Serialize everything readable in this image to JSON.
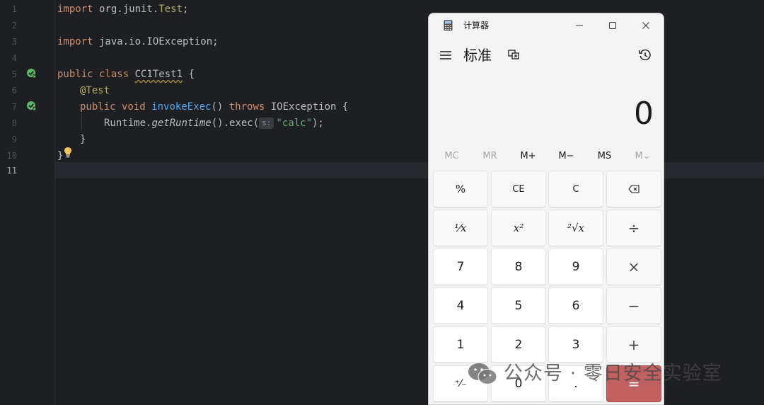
{
  "editor": {
    "line_numbers": [
      "1",
      "2",
      "3",
      "4",
      "5",
      "6",
      "7",
      "8",
      "9",
      "10",
      "11"
    ],
    "lines": {
      "l1": {
        "kw": "import",
        "pkg": " org.junit.",
        "cls": "Test",
        "end": ";"
      },
      "l3": {
        "kw": "import",
        "pkg": " java.io.IOException;"
      },
      "l5": {
        "kw": "public class ",
        "cls": "CC1Test1",
        "end": " {"
      },
      "l6": {
        "ann": "@Test"
      },
      "l7": {
        "kw1": "public void ",
        "fn": "invokeExec",
        "mid": "() ",
        "kw2": "throws",
        "end": " IOException {"
      },
      "l8": {
        "pre": "Runtime.",
        "call": "getRuntime",
        "mid": "().exec(",
        "hint": "s:",
        "str": "\"calc\"",
        "end": ");"
      },
      "l9": {
        "text": "}"
      },
      "l10": {
        "text": "}"
      }
    }
  },
  "calculator": {
    "window_title": "计算器",
    "mode_title": "标准",
    "display_value": "0",
    "memory": [
      "MC",
      "MR",
      "M+",
      "M−",
      "MS",
      "M⌄"
    ],
    "keys": [
      [
        "%",
        "CE",
        "C",
        "⌫"
      ],
      [
        "¹⁄x",
        "x²",
        "²√x",
        "÷"
      ],
      [
        "7",
        "8",
        "9",
        "×"
      ],
      [
        "4",
        "5",
        "6",
        "−"
      ],
      [
        "1",
        "2",
        "3",
        "+"
      ],
      [
        "⁺⁄₋",
        "0",
        ".",
        "="
      ]
    ],
    "colors": {
      "accent": "#c06060",
      "background": "#f3f3f3"
    }
  },
  "watermark": {
    "text": "公众号 · 零日安全实验室"
  }
}
